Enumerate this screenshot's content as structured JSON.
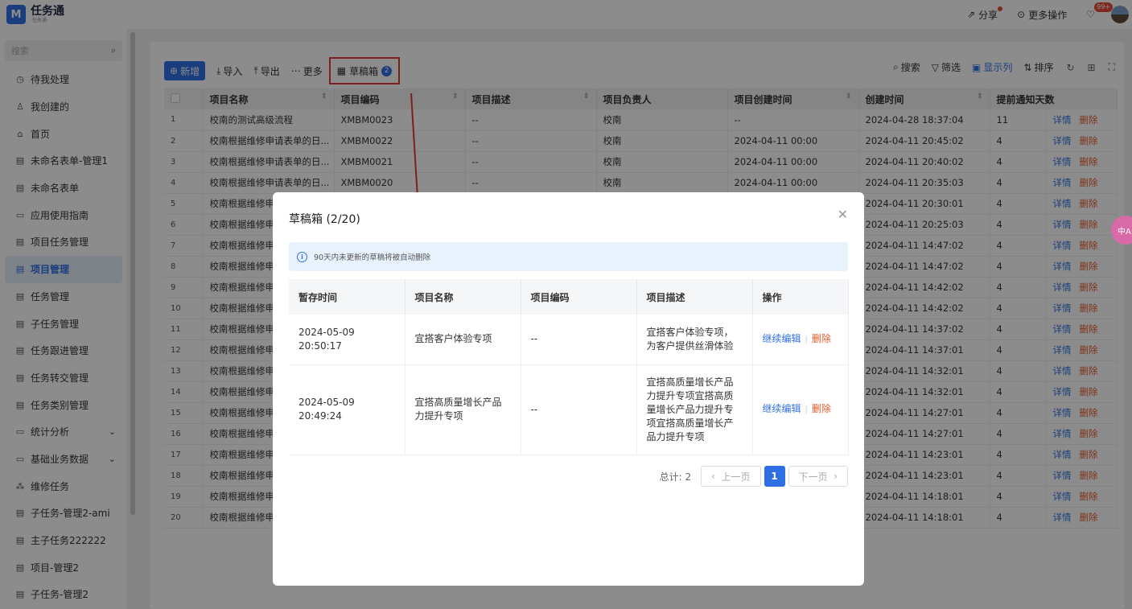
{
  "app": {
    "logo_char": "M",
    "name": "任务通",
    "subtitle": "·任务通·"
  },
  "header": {
    "share": "分享",
    "more_ops": "更多操作",
    "notif_badge": "99+"
  },
  "sidebar": {
    "search_placeholder": "搜索",
    "items": [
      {
        "label": "待我处理",
        "icon": "◷"
      },
      {
        "label": "我创建的",
        "icon": "♙"
      },
      {
        "label": "首页",
        "icon": "⌂"
      },
      {
        "label": "未命名表单-管理1",
        "icon": "▤"
      },
      {
        "label": "未命名表单",
        "icon": "▤"
      },
      {
        "label": "应用使用指南",
        "icon": "▭"
      },
      {
        "label": "项目任务管理",
        "icon": "▤"
      },
      {
        "label": "项目管理",
        "icon": "▤",
        "active": true
      },
      {
        "label": "任务管理",
        "icon": "▤"
      },
      {
        "label": "子任务管理",
        "icon": "▤"
      },
      {
        "label": "任务跟进管理",
        "icon": "▤"
      },
      {
        "label": "任务转交管理",
        "icon": "▤"
      },
      {
        "label": "任务类别管理",
        "icon": "▤"
      },
      {
        "label": "统计分析",
        "icon": "▭",
        "expand": "⌄"
      },
      {
        "label": "基础业务数据",
        "icon": "▭",
        "expand": "⌄"
      },
      {
        "label": "维修任务",
        "icon": "⁂"
      },
      {
        "label": "子任务-管理2-ami",
        "icon": "▤"
      },
      {
        "label": "主子任务222222",
        "icon": "▤"
      },
      {
        "label": "项目-管理2",
        "icon": "▤"
      },
      {
        "label": "子任务-管理2",
        "icon": "▤"
      }
    ]
  },
  "toolbar": {
    "add": "新增",
    "import": "导入",
    "export": "导出",
    "more": "更多",
    "draft": "草稿箱",
    "draft_count": "2",
    "search": "搜索",
    "filter": "筛选",
    "columns": "显示列",
    "sort": "排序"
  },
  "grid": {
    "columns": [
      "项目名称",
      "项目编码",
      "项目描述",
      "项目负责人",
      "项目创建时间",
      "创建时间",
      "提前通知天数"
    ],
    "detail": "详情",
    "delete": "删除",
    "rows": [
      {
        "n": "1",
        "name": "校南的测试高级流程",
        "code": "XMBM0023",
        "desc": "--",
        "owner": "校南",
        "ptime": "--",
        "ctime": "2024-04-28 18:37:04",
        "days": "11"
      },
      {
        "n": "2",
        "name": "校南根据维修申请表单的日...",
        "code": "XMBM0022",
        "desc": "--",
        "owner": "校南",
        "ptime": "2024-04-11 00:00",
        "ctime": "2024-04-11 20:45:02",
        "days": "4"
      },
      {
        "n": "3",
        "name": "校南根据维修申请表单的日...",
        "code": "XMBM0021",
        "desc": "--",
        "owner": "校南",
        "ptime": "2024-04-11 00:00",
        "ctime": "2024-04-11 20:40:02",
        "days": "4"
      },
      {
        "n": "4",
        "name": "校南根据维修申请表单的日...",
        "code": "XMBM0020",
        "desc": "--",
        "owner": "校南",
        "ptime": "2024-04-11 00:00",
        "ctime": "2024-04-11 20:35:03",
        "days": "4"
      },
      {
        "n": "5",
        "name": "校南根据维修申",
        "code": "",
        "desc": "",
        "owner": "",
        "ptime": "",
        "ctime": "2024-04-11 20:30:01",
        "days": "4"
      },
      {
        "n": "6",
        "name": "校南根据维修申",
        "code": "",
        "desc": "",
        "owner": "",
        "ptime": "",
        "ctime": "2024-04-11 20:25:03",
        "days": "4"
      },
      {
        "n": "7",
        "name": "校南根据维修申",
        "code": "",
        "desc": "",
        "owner": "",
        "ptime": "",
        "ctime": "2024-04-11 14:47:02",
        "days": "4"
      },
      {
        "n": "8",
        "name": "校南根据维修申",
        "code": "",
        "desc": "",
        "owner": "",
        "ptime": "",
        "ctime": "2024-04-11 14:47:02",
        "days": "4"
      },
      {
        "n": "9",
        "name": "校南根据维修申",
        "code": "",
        "desc": "",
        "owner": "",
        "ptime": "",
        "ctime": "2024-04-11 14:42:02",
        "days": "4"
      },
      {
        "n": "10",
        "name": "校南根据维修申",
        "code": "",
        "desc": "",
        "owner": "",
        "ptime": "",
        "ctime": "2024-04-11 14:42:02",
        "days": "4"
      },
      {
        "n": "11",
        "name": "校南根据维修申",
        "code": "",
        "desc": "",
        "owner": "",
        "ptime": "",
        "ctime": "2024-04-11 14:37:02",
        "days": "4"
      },
      {
        "n": "12",
        "name": "校南根据维修申",
        "code": "",
        "desc": "",
        "owner": "",
        "ptime": "",
        "ctime": "2024-04-11 14:37:01",
        "days": "4"
      },
      {
        "n": "13",
        "name": "校南根据维修申",
        "code": "",
        "desc": "",
        "owner": "",
        "ptime": "",
        "ctime": "2024-04-11 14:32:01",
        "days": "4"
      },
      {
        "n": "14",
        "name": "校南根据维修申",
        "code": "",
        "desc": "",
        "owner": "",
        "ptime": "",
        "ctime": "2024-04-11 14:32:01",
        "days": "4"
      },
      {
        "n": "15",
        "name": "校南根据维修申",
        "code": "",
        "desc": "",
        "owner": "",
        "ptime": "",
        "ctime": "2024-04-11 14:27:01",
        "days": "4"
      },
      {
        "n": "16",
        "name": "校南根据维修申",
        "code": "",
        "desc": "",
        "owner": "",
        "ptime": "",
        "ctime": "2024-04-11 14:27:01",
        "days": "4"
      },
      {
        "n": "17",
        "name": "校南根据维修申",
        "code": "",
        "desc": "",
        "owner": "",
        "ptime": "",
        "ctime": "2024-04-11 14:23:01",
        "days": "4"
      },
      {
        "n": "18",
        "name": "校南根据维修申",
        "code": "",
        "desc": "",
        "owner": "",
        "ptime": "",
        "ctime": "2024-04-11 14:23:01",
        "days": "4"
      },
      {
        "n": "19",
        "name": "校南根据维修申",
        "code": "",
        "desc": "",
        "owner": "",
        "ptime": "",
        "ctime": "2024-04-11 14:18:01",
        "days": "4"
      },
      {
        "n": "20",
        "name": "校南根据维修申",
        "code": "",
        "desc": "",
        "owner": "",
        "ptime": "",
        "ctime": "2024-04-11 14:18:01",
        "days": "4"
      }
    ]
  },
  "modal": {
    "title": "草稿箱 (2/20)",
    "notice": "90天内未更新的草稿将被自动删除",
    "columns": [
      "暂存时间",
      "项目名称",
      "项目编码",
      "项目描述",
      "操作"
    ],
    "edit": "继续编辑",
    "delete": "删除",
    "rows": [
      {
        "time": "2024-05-09 20:50:17",
        "name": "宜搭客户体验专项",
        "code": "--",
        "desc": "宜搭客户体验专项，为客户提供丝滑体验"
      },
      {
        "time": "2024-05-09 20:49:24",
        "name": "宜搭高质量增长产品力提升专项",
        "code": "--",
        "desc": "宜搭高质量增长产品力提升专项宜搭高质量增长产品力提升专项宜搭高质量增长产品力提升专项"
      }
    ],
    "pager": {
      "total": "总计: 2",
      "prev": "上一页",
      "page": "1",
      "next": "下一页"
    }
  },
  "float_badge": "中A"
}
